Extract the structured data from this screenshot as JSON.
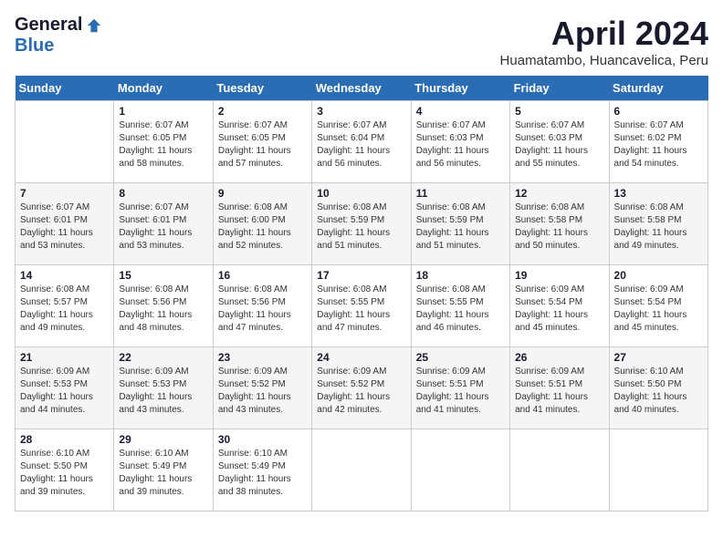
{
  "header": {
    "logo_general": "General",
    "logo_blue": "Blue",
    "title": "April 2024",
    "location": "Huamatambo, Huancavelica, Peru"
  },
  "days_of_week": [
    "Sunday",
    "Monday",
    "Tuesday",
    "Wednesday",
    "Thursday",
    "Friday",
    "Saturday"
  ],
  "weeks": [
    [
      {
        "day": "",
        "sunrise": "",
        "sunset": "",
        "daylight": ""
      },
      {
        "day": "1",
        "sunrise": "Sunrise: 6:07 AM",
        "sunset": "Sunset: 6:05 PM",
        "daylight": "Daylight: 11 hours and 58 minutes."
      },
      {
        "day": "2",
        "sunrise": "Sunrise: 6:07 AM",
        "sunset": "Sunset: 6:05 PM",
        "daylight": "Daylight: 11 hours and 57 minutes."
      },
      {
        "day": "3",
        "sunrise": "Sunrise: 6:07 AM",
        "sunset": "Sunset: 6:04 PM",
        "daylight": "Daylight: 11 hours and 56 minutes."
      },
      {
        "day": "4",
        "sunrise": "Sunrise: 6:07 AM",
        "sunset": "Sunset: 6:03 PM",
        "daylight": "Daylight: 11 hours and 56 minutes."
      },
      {
        "day": "5",
        "sunrise": "Sunrise: 6:07 AM",
        "sunset": "Sunset: 6:03 PM",
        "daylight": "Daylight: 11 hours and 55 minutes."
      },
      {
        "day": "6",
        "sunrise": "Sunrise: 6:07 AM",
        "sunset": "Sunset: 6:02 PM",
        "daylight": "Daylight: 11 hours and 54 minutes."
      }
    ],
    [
      {
        "day": "7",
        "sunrise": "Sunrise: 6:07 AM",
        "sunset": "Sunset: 6:01 PM",
        "daylight": "Daylight: 11 hours and 53 minutes."
      },
      {
        "day": "8",
        "sunrise": "Sunrise: 6:07 AM",
        "sunset": "Sunset: 6:01 PM",
        "daylight": "Daylight: 11 hours and 53 minutes."
      },
      {
        "day": "9",
        "sunrise": "Sunrise: 6:08 AM",
        "sunset": "Sunset: 6:00 PM",
        "daylight": "Daylight: 11 hours and 52 minutes."
      },
      {
        "day": "10",
        "sunrise": "Sunrise: 6:08 AM",
        "sunset": "Sunset: 5:59 PM",
        "daylight": "Daylight: 11 hours and 51 minutes."
      },
      {
        "day": "11",
        "sunrise": "Sunrise: 6:08 AM",
        "sunset": "Sunset: 5:59 PM",
        "daylight": "Daylight: 11 hours and 51 minutes."
      },
      {
        "day": "12",
        "sunrise": "Sunrise: 6:08 AM",
        "sunset": "Sunset: 5:58 PM",
        "daylight": "Daylight: 11 hours and 50 minutes."
      },
      {
        "day": "13",
        "sunrise": "Sunrise: 6:08 AM",
        "sunset": "Sunset: 5:58 PM",
        "daylight": "Daylight: 11 hours and 49 minutes."
      }
    ],
    [
      {
        "day": "14",
        "sunrise": "Sunrise: 6:08 AM",
        "sunset": "Sunset: 5:57 PM",
        "daylight": "Daylight: 11 hours and 49 minutes."
      },
      {
        "day": "15",
        "sunrise": "Sunrise: 6:08 AM",
        "sunset": "Sunset: 5:56 PM",
        "daylight": "Daylight: 11 hours and 48 minutes."
      },
      {
        "day": "16",
        "sunrise": "Sunrise: 6:08 AM",
        "sunset": "Sunset: 5:56 PM",
        "daylight": "Daylight: 11 hours and 47 minutes."
      },
      {
        "day": "17",
        "sunrise": "Sunrise: 6:08 AM",
        "sunset": "Sunset: 5:55 PM",
        "daylight": "Daylight: 11 hours and 47 minutes."
      },
      {
        "day": "18",
        "sunrise": "Sunrise: 6:08 AM",
        "sunset": "Sunset: 5:55 PM",
        "daylight": "Daylight: 11 hours and 46 minutes."
      },
      {
        "day": "19",
        "sunrise": "Sunrise: 6:09 AM",
        "sunset": "Sunset: 5:54 PM",
        "daylight": "Daylight: 11 hours and 45 minutes."
      },
      {
        "day": "20",
        "sunrise": "Sunrise: 6:09 AM",
        "sunset": "Sunset: 5:54 PM",
        "daylight": "Daylight: 11 hours and 45 minutes."
      }
    ],
    [
      {
        "day": "21",
        "sunrise": "Sunrise: 6:09 AM",
        "sunset": "Sunset: 5:53 PM",
        "daylight": "Daylight: 11 hours and 44 minutes."
      },
      {
        "day": "22",
        "sunrise": "Sunrise: 6:09 AM",
        "sunset": "Sunset: 5:53 PM",
        "daylight": "Daylight: 11 hours and 43 minutes."
      },
      {
        "day": "23",
        "sunrise": "Sunrise: 6:09 AM",
        "sunset": "Sunset: 5:52 PM",
        "daylight": "Daylight: 11 hours and 43 minutes."
      },
      {
        "day": "24",
        "sunrise": "Sunrise: 6:09 AM",
        "sunset": "Sunset: 5:52 PM",
        "daylight": "Daylight: 11 hours and 42 minutes."
      },
      {
        "day": "25",
        "sunrise": "Sunrise: 6:09 AM",
        "sunset": "Sunset: 5:51 PM",
        "daylight": "Daylight: 11 hours and 41 minutes."
      },
      {
        "day": "26",
        "sunrise": "Sunrise: 6:09 AM",
        "sunset": "Sunset: 5:51 PM",
        "daylight": "Daylight: 11 hours and 41 minutes."
      },
      {
        "day": "27",
        "sunrise": "Sunrise: 6:10 AM",
        "sunset": "Sunset: 5:50 PM",
        "daylight": "Daylight: 11 hours and 40 minutes."
      }
    ],
    [
      {
        "day": "28",
        "sunrise": "Sunrise: 6:10 AM",
        "sunset": "Sunset: 5:50 PM",
        "daylight": "Daylight: 11 hours and 39 minutes."
      },
      {
        "day": "29",
        "sunrise": "Sunrise: 6:10 AM",
        "sunset": "Sunset: 5:49 PM",
        "daylight": "Daylight: 11 hours and 39 minutes."
      },
      {
        "day": "30",
        "sunrise": "Sunrise: 6:10 AM",
        "sunset": "Sunset: 5:49 PM",
        "daylight": "Daylight: 11 hours and 38 minutes."
      },
      {
        "day": "",
        "sunrise": "",
        "sunset": "",
        "daylight": ""
      },
      {
        "day": "",
        "sunrise": "",
        "sunset": "",
        "daylight": ""
      },
      {
        "day": "",
        "sunrise": "",
        "sunset": "",
        "daylight": ""
      },
      {
        "day": "",
        "sunrise": "",
        "sunset": "",
        "daylight": ""
      }
    ]
  ]
}
